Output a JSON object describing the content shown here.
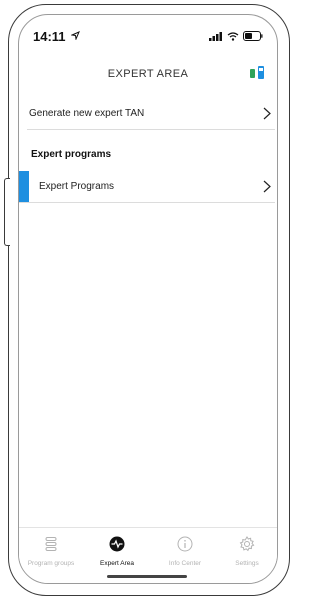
{
  "status_bar": {
    "time": "14:11"
  },
  "header": {
    "title": "EXPERT AREA"
  },
  "rows": {
    "generate_tan": {
      "label": "Generate new expert TAN"
    }
  },
  "section": {
    "title": "Expert programs"
  },
  "programs_row": {
    "label": "Expert Programs"
  },
  "tabs": [
    {
      "label": "Program groups",
      "icon": "list-icon",
      "active": false
    },
    {
      "label": "Expert Area",
      "icon": "pulse-icon",
      "active": true
    },
    {
      "label": "Info Center",
      "icon": "info-icon",
      "active": false
    },
    {
      "label": "Settings",
      "icon": "gear-icon",
      "active": false
    }
  ],
  "colors": {
    "accent": "#1e8fe0",
    "inactive_tab": "#b3b3b3",
    "active_tab": "#111111",
    "device_icon_green": "#2fa35a",
    "device_icon_blue": "#1e8fe0"
  }
}
